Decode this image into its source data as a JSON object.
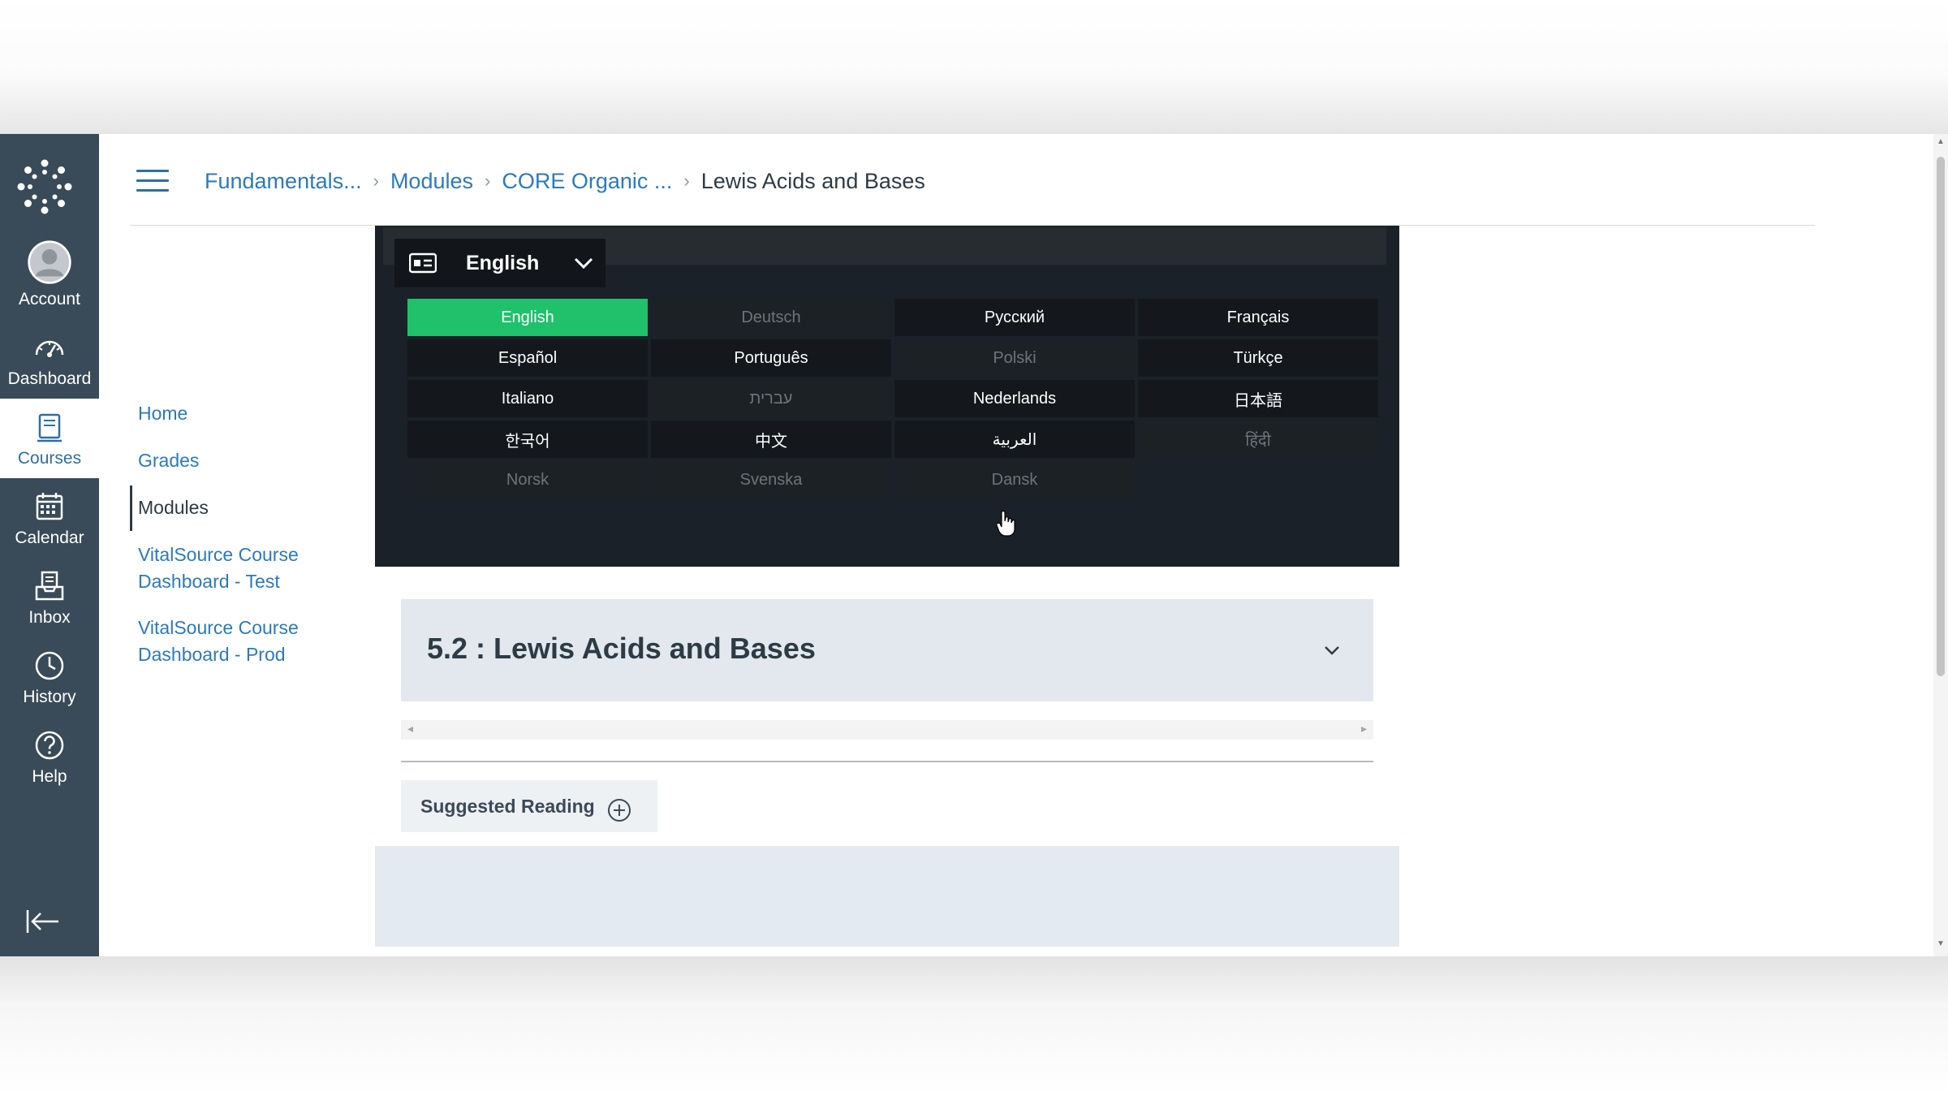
{
  "global_nav": {
    "items": [
      {
        "label": "Account",
        "icon": "account-icon"
      },
      {
        "label": "Dashboard",
        "icon": "dashboard-icon"
      },
      {
        "label": "Courses",
        "icon": "courses-icon"
      },
      {
        "label": "Calendar",
        "icon": "calendar-icon"
      },
      {
        "label": "Inbox",
        "icon": "inbox-icon"
      },
      {
        "label": "History",
        "icon": "history-icon"
      },
      {
        "label": "Help",
        "icon": "help-icon"
      }
    ],
    "active": "Courses",
    "colors": {
      "background": "#394b58",
      "active_text": "#2d6fa3"
    }
  },
  "breadcrumb": {
    "items": [
      "Fundamentals...",
      "Modules",
      "CORE Organic ...",
      "Lewis Acids and Bases"
    ]
  },
  "course_nav": {
    "items": [
      {
        "label": "Home"
      },
      {
        "label": "Grades"
      },
      {
        "label": "Modules"
      },
      {
        "label": "VitalSource Course Dashboard - Test"
      },
      {
        "label": "VitalSource Course Dashboard - Prod"
      }
    ],
    "active": "Modules"
  },
  "video": {
    "caption_selector": {
      "selected": "English",
      "icon": "closed-captions-icon"
    },
    "languages": [
      {
        "label": "English",
        "state": "selected"
      },
      {
        "label": "Deutsch",
        "state": "dimmed"
      },
      {
        "label": "Русский",
        "state": "normal"
      },
      {
        "label": "Français",
        "state": "normal"
      },
      {
        "label": "Español",
        "state": "normal"
      },
      {
        "label": "Português",
        "state": "normal"
      },
      {
        "label": "Polski",
        "state": "dimmed"
      },
      {
        "label": "Türkçe",
        "state": "normal"
      },
      {
        "label": "Italiano",
        "state": "normal"
      },
      {
        "label": "עברית",
        "state": "dimmed"
      },
      {
        "label": "Nederlands",
        "state": "normal"
      },
      {
        "label": "日本語",
        "state": "normal"
      },
      {
        "label": "한국어",
        "state": "normal"
      },
      {
        "label": "中文",
        "state": "normal"
      },
      {
        "label": "العربية",
        "state": "normal"
      },
      {
        "label": "हिंदी",
        "state": "dimmed"
      },
      {
        "label": "Norsk",
        "state": "dimmed"
      },
      {
        "label": "Svenska",
        "state": "dimmed"
      },
      {
        "label": "Dansk",
        "state": "dimmed"
      }
    ],
    "colors": {
      "selected": "#1fc16b",
      "panel": "#1b2128"
    }
  },
  "module": {
    "title": "5.2 : Lewis Acids and Bases",
    "suggested_reading_label": "Suggested Reading"
  }
}
